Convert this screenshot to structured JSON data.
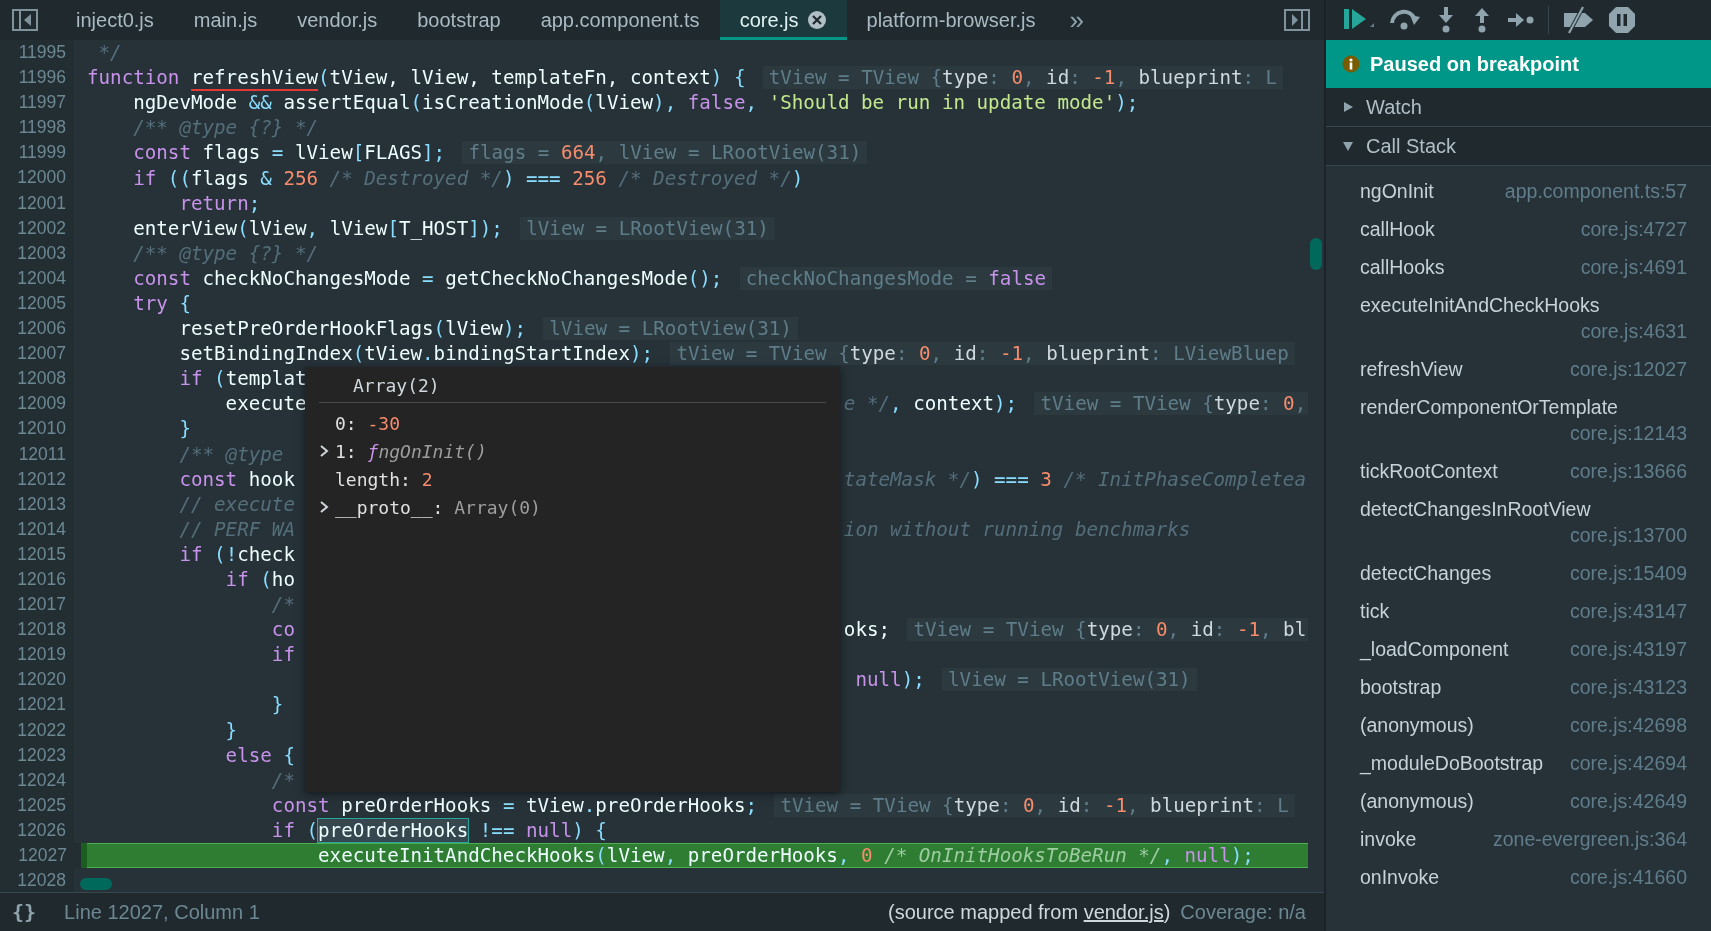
{
  "tabs": [
    {
      "label": "inject0.js",
      "selected": false
    },
    {
      "label": "main.js",
      "selected": false
    },
    {
      "label": "vendor.js",
      "selected": false
    },
    {
      "label": "bootstrap",
      "selected": false
    },
    {
      "label": "app.component.ts",
      "selected": false
    },
    {
      "label": "core.js",
      "selected": true
    },
    {
      "label": "platform-browser.js",
      "selected": false
    }
  ],
  "more_tabs": "»",
  "lines": [
    {
      "num": "11995",
      "paused": false,
      "code": [
        {
          "text": " */",
          "kind": "cm"
        }
      ]
    },
    {
      "num": "11996",
      "paused": false,
      "code": [
        {
          "text": "function ",
          "kind": "kw"
        },
        {
          "text": "refreshView",
          "kind": "hover"
        },
        {
          "text": "(",
          "kind": "pn"
        },
        {
          "text": "tView, lView, templateFn, context",
          "kind": "id"
        },
        {
          "text": ") {",
          "kind": "pn"
        }
      ],
      "hint": [
        {
          "text": "tView = TView {",
          "kind": "h"
        },
        {
          "text": "type",
          "kind": "key"
        },
        {
          "text": ": ",
          "kind": "h"
        },
        {
          "text": "0",
          "kind": "num"
        },
        {
          "text": ", ",
          "kind": "h"
        },
        {
          "text": "id",
          "kind": "key"
        },
        {
          "text": ": ",
          "kind": "h"
        },
        {
          "text": "-1",
          "kind": "num"
        },
        {
          "text": ", ",
          "kind": "h"
        },
        {
          "text": "blueprint",
          "kind": "key"
        },
        {
          "text": ": L",
          "kind": "h"
        }
      ]
    },
    {
      "num": "11997",
      "paused": false,
      "code": [
        {
          "text": "    ngDevMode ",
          "kind": "id"
        },
        {
          "text": "&&",
          "kind": "pn"
        },
        {
          "text": " assertEqual",
          "kind": "id"
        },
        {
          "text": "(",
          "kind": "pn"
        },
        {
          "text": "isCreationMode",
          "kind": "id"
        },
        {
          "text": "(",
          "kind": "pn"
        },
        {
          "text": "lView",
          "kind": "id"
        },
        {
          "text": "), ",
          "kind": "pn"
        },
        {
          "text": "false",
          "kind": "kw"
        },
        {
          "text": ", ",
          "kind": "pn"
        },
        {
          "text": "'Should be run in update mode'",
          "kind": "str"
        },
        {
          "text": ");",
          "kind": "pn"
        }
      ]
    },
    {
      "num": "11998",
      "paused": false,
      "code": [
        {
          "text": "    /** @type {?} */",
          "kind": "cm"
        }
      ]
    },
    {
      "num": "11999",
      "paused": false,
      "code": [
        {
          "text": "    const",
          "kind": "kw"
        },
        {
          "text": " flags ",
          "kind": "id"
        },
        {
          "text": "=",
          "kind": "pn"
        },
        {
          "text": " lView",
          "kind": "id"
        },
        {
          "text": "[",
          "kind": "pn"
        },
        {
          "text": "FLAGS",
          "kind": "id"
        },
        {
          "text": "];",
          "kind": "pn"
        }
      ],
      "hint": [
        {
          "text": "flags = ",
          "kind": "h"
        },
        {
          "text": "664",
          "kind": "num"
        },
        {
          "text": ", lView = LRootView(31)",
          "kind": "h"
        }
      ]
    },
    {
      "num": "12000",
      "paused": false,
      "code": [
        {
          "text": "    if",
          "kind": "kw"
        },
        {
          "text": " ((",
          "kind": "pn"
        },
        {
          "text": "flags ",
          "kind": "id"
        },
        {
          "text": "& ",
          "kind": "pn"
        },
        {
          "text": "256",
          "kind": "num"
        },
        {
          "text": " /* Destroyed */",
          "kind": "cm"
        },
        {
          "text": ")",
          "kind": "pn"
        },
        {
          "text": " === ",
          "kind": "pn"
        },
        {
          "text": "256",
          "kind": "num"
        },
        {
          "text": " /* Destroyed */",
          "kind": "cm"
        },
        {
          "text": ")",
          "kind": "pn"
        }
      ]
    },
    {
      "num": "12001",
      "paused": false,
      "code": [
        {
          "text": "        return",
          "kind": "kw"
        },
        {
          "text": ";",
          "kind": "pn"
        }
      ]
    },
    {
      "num": "12002",
      "paused": false,
      "code": [
        {
          "text": "    enterView",
          "kind": "id"
        },
        {
          "text": "(",
          "kind": "pn"
        },
        {
          "text": "lView",
          "kind": "id"
        },
        {
          "text": ", ",
          "kind": "pn"
        },
        {
          "text": "lView",
          "kind": "id"
        },
        {
          "text": "[",
          "kind": "pn"
        },
        {
          "text": "T_HOST",
          "kind": "id"
        },
        {
          "text": "]);",
          "kind": "pn"
        }
      ],
      "hint": [
        {
          "text": "lView = LRootView(31)",
          "kind": "h"
        }
      ]
    },
    {
      "num": "12003",
      "paused": false,
      "code": [
        {
          "text": "    /** @type {?} */",
          "kind": "cm"
        }
      ]
    },
    {
      "num": "12004",
      "paused": false,
      "code": [
        {
          "text": "    const",
          "kind": "kw"
        },
        {
          "text": " checkNoChangesMode ",
          "kind": "id"
        },
        {
          "text": "=",
          "kind": "pn"
        },
        {
          "text": " getCheckNoChangesMode",
          "kind": "id"
        },
        {
          "text": "();",
          "kind": "pn"
        }
      ],
      "hint": [
        {
          "text": "checkNoChangesMode = ",
          "kind": "h"
        },
        {
          "text": "false",
          "kind": "kw"
        }
      ]
    },
    {
      "num": "12005",
      "paused": false,
      "code": [
        {
          "text": "    try",
          "kind": "kw"
        },
        {
          "text": " {",
          "kind": "pn"
        }
      ]
    },
    {
      "num": "12006",
      "paused": false,
      "code": [
        {
          "text": "        resetPreOrderHookFlags",
          "kind": "id"
        },
        {
          "text": "(",
          "kind": "pn"
        },
        {
          "text": "lView",
          "kind": "id"
        },
        {
          "text": ");",
          "kind": "pn"
        }
      ],
      "hint": [
        {
          "text": "lView = LRootView(31)",
          "kind": "h"
        }
      ]
    },
    {
      "num": "12007",
      "paused": false,
      "code": [
        {
          "text": "        setBindingIndex",
          "kind": "id"
        },
        {
          "text": "(",
          "kind": "pn"
        },
        {
          "text": "tView",
          "kind": "id"
        },
        {
          "text": ".",
          "kind": "pn"
        },
        {
          "text": "bindingStartIndex",
          "kind": "id"
        },
        {
          "text": ");",
          "kind": "pn"
        }
      ],
      "hint": [
        {
          "text": "tView = TView {",
          "kind": "h"
        },
        {
          "text": "type",
          "kind": "key"
        },
        {
          "text": ": ",
          "kind": "h"
        },
        {
          "text": "0",
          "kind": "num"
        },
        {
          "text": ", ",
          "kind": "h"
        },
        {
          "text": "id",
          "kind": "key"
        },
        {
          "text": ": ",
          "kind": "h"
        },
        {
          "text": "-1",
          "kind": "num"
        },
        {
          "text": ", ",
          "kind": "h"
        },
        {
          "text": "blueprint",
          "kind": "key"
        },
        {
          "text": ": LViewBluep",
          "kind": "h"
        }
      ]
    },
    {
      "num": "12008",
      "paused": false,
      "code": [
        {
          "text": "        if",
          "kind": "kw"
        },
        {
          "text": " (",
          "kind": "pn"
        },
        {
          "text": "templat",
          "kind": "id"
        }
      ]
    },
    {
      "num": "12009",
      "paused": false,
      "code": [
        {
          "text": "            execute",
          "kind": "id"
        }
      ],
      "after": [
        {
          "text": "e */",
          "kind": "cm"
        },
        {
          "text": ", ",
          "kind": "pn"
        },
        {
          "text": "context",
          "kind": "id"
        },
        {
          "text": ");",
          "kind": "pn"
        }
      ],
      "after_hint": [
        {
          "text": "tView = TView {",
          "kind": "h"
        },
        {
          "text": "type",
          "kind": "key"
        },
        {
          "text": ": ",
          "kind": "h"
        },
        {
          "text": "0",
          "kind": "num"
        },
        {
          "text": ",",
          "kind": "h"
        }
      ]
    },
    {
      "num": "12010",
      "paused": false,
      "code": [
        {
          "text": "        }",
          "kind": "pn"
        }
      ]
    },
    {
      "num": "12011",
      "paused": false,
      "code": [
        {
          "text": "        /** @type",
          "kind": "cm"
        }
      ]
    },
    {
      "num": "12012",
      "paused": false,
      "code": [
        {
          "text": "        const",
          "kind": "kw"
        },
        {
          "text": " hook",
          "kind": "id"
        }
      ],
      "after": [
        {
          "text": "tateMask */",
          "kind": "cm"
        },
        {
          "text": ")",
          "kind": "pn"
        },
        {
          "text": " === ",
          "kind": "pn"
        },
        {
          "text": "3",
          "kind": "num"
        },
        {
          "text": " /* InitPhaseCompletea",
          "kind": "cm"
        }
      ]
    },
    {
      "num": "12013",
      "paused": false,
      "code": [
        {
          "text": "        // execute",
          "kind": "cm"
        }
      ]
    },
    {
      "num": "12014",
      "paused": false,
      "code": [
        {
          "text": "        // PERF WA",
          "kind": "cm"
        }
      ],
      "after": [
        {
          "text": "ion without running benchmarks",
          "kind": "cm"
        }
      ]
    },
    {
      "num": "12015",
      "paused": false,
      "code": [
        {
          "text": "        if",
          "kind": "kw"
        },
        {
          "text": " (!",
          "kind": "pn"
        },
        {
          "text": "check",
          "kind": "id"
        }
      ]
    },
    {
      "num": "12016",
      "paused": false,
      "code": [
        {
          "text": "            if",
          "kind": "kw"
        },
        {
          "text": " (",
          "kind": "pn"
        },
        {
          "text": "ho",
          "kind": "id"
        }
      ]
    },
    {
      "num": "12017",
      "paused": false,
      "code": [
        {
          "text": "                /*",
          "kind": "cm"
        }
      ]
    },
    {
      "num": "12018",
      "paused": false,
      "code": [
        {
          "text": "                co",
          "kind": "kw"
        }
      ],
      "after": [
        {
          "text": "oks;",
          "kind": "id"
        }
      ],
      "after_hint": [
        {
          "text": "tView = TView {",
          "kind": "h"
        },
        {
          "text": "type",
          "kind": "key"
        },
        {
          "text": ": ",
          "kind": "h"
        },
        {
          "text": "0",
          "kind": "num"
        },
        {
          "text": ", ",
          "kind": "h"
        },
        {
          "text": "id",
          "kind": "key"
        },
        {
          "text": ": ",
          "kind": "h"
        },
        {
          "text": "-1",
          "kind": "num"
        },
        {
          "text": ", ",
          "kind": "h"
        },
        {
          "text": "bl",
          "kind": "key"
        }
      ]
    },
    {
      "num": "12019",
      "paused": false,
      "code": [
        {
          "text": "                if",
          "kind": "kw"
        }
      ]
    },
    {
      "num": "12020",
      "paused": false,
      "after": [
        {
          "text": " null",
          "kind": "kw"
        },
        {
          "text": ");",
          "kind": "pn"
        }
      ],
      "after_hint": [
        {
          "text": "lView = LRootView(31)",
          "kind": "h"
        }
      ]
    },
    {
      "num": "12021",
      "paused": false,
      "code": [
        {
          "text": "                }",
          "kind": "pn"
        }
      ]
    },
    {
      "num": "12022",
      "paused": false,
      "code": [
        {
          "text": "            }",
          "kind": "pn"
        }
      ]
    },
    {
      "num": "12023",
      "paused": false,
      "code": [
        {
          "text": "            else",
          "kind": "kw"
        },
        {
          "text": " {",
          "kind": "pn"
        }
      ]
    },
    {
      "num": "12024",
      "paused": false,
      "code": [
        {
          "text": "                /*",
          "kind": "cm"
        }
      ]
    },
    {
      "num": "12025",
      "paused": false,
      "code": [
        {
          "text": "                const",
          "kind": "kw"
        },
        {
          "text": " preOrderHooks ",
          "kind": "id"
        },
        {
          "text": "=",
          "kind": "pn"
        },
        {
          "text": " tView",
          "kind": "id"
        },
        {
          "text": ".",
          "kind": "pn"
        },
        {
          "text": "preOrderHooks",
          "kind": "id"
        },
        {
          "text": ";",
          "kind": "pn"
        }
      ],
      "hint": [
        {
          "text": "tView = TView {",
          "kind": "h"
        },
        {
          "text": "type",
          "kind": "key"
        },
        {
          "text": ": ",
          "kind": "h"
        },
        {
          "text": "0",
          "kind": "num"
        },
        {
          "text": ", ",
          "kind": "h"
        },
        {
          "text": "id",
          "kind": "key"
        },
        {
          "text": ": ",
          "kind": "h"
        },
        {
          "text": "-1",
          "kind": "num"
        },
        {
          "text": ", ",
          "kind": "h"
        },
        {
          "text": "blueprint",
          "kind": "key"
        },
        {
          "text": ": L",
          "kind": "h"
        }
      ]
    },
    {
      "num": "12026",
      "paused": false,
      "code": [
        {
          "text": "                if",
          "kind": "kw"
        },
        {
          "text": " (",
          "kind": "pn"
        },
        {
          "text": "preOrderHooks",
          "kind": "hl"
        },
        {
          "text": " !==",
          "kind": "pn"
        },
        {
          "text": " null",
          "kind": "kw"
        },
        {
          "text": ") {",
          "kind": "pn"
        }
      ]
    },
    {
      "num": "12027",
      "paused": true,
      "code": [
        {
          "text": "                    executeInitAndCheckHooks",
          "kind": "id"
        },
        {
          "text": "(",
          "kind": "pn"
        },
        {
          "text": "lView",
          "kind": "id"
        },
        {
          "text": ", ",
          "kind": "pn"
        },
        {
          "text": "preOrderHooks",
          "kind": "id"
        },
        {
          "text": ", ",
          "kind": "pn"
        },
        {
          "text": "0",
          "kind": "num"
        },
        {
          "text": " /* OnInitHooksToBeRun */",
          "kind": "cm"
        },
        {
          "text": ", ",
          "kind": "pn"
        },
        {
          "text": "null",
          "kind": "kw"
        },
        {
          "text": ");",
          "kind": "pn"
        }
      ]
    },
    {
      "num": "12028",
      "paused": false
    }
  ],
  "popover": {
    "title": "Array(2)",
    "rows": [
      {
        "expandable": false,
        "key": "0:",
        "value": "-30",
        "kind": "number"
      },
      {
        "expandable": true,
        "key": "1:",
        "prefix": "ƒ",
        "value": "ngOnInit()",
        "kind": "function"
      },
      {
        "expandable": false,
        "key": "length:",
        "value": "2",
        "kind": "number"
      },
      {
        "expandable": true,
        "key": "__proto__:",
        "value": "Array(0)",
        "kind": "object"
      }
    ]
  },
  "status_bar": {
    "format": "{}",
    "position": "Line 12027, Column 1",
    "source_note": {
      "before": "(source mapped from ",
      "link": "vendor.js",
      "after": ")"
    },
    "coverage": "Coverage: n/a"
  },
  "debugger": {
    "banner": "Paused on breakpoint",
    "sections": [
      {
        "label": "Watch",
        "expanded": false
      },
      {
        "label": "Call Stack",
        "expanded": true
      }
    ],
    "call_stack": [
      {
        "name": "ngOnInit",
        "location": "app.component.ts:57"
      },
      {
        "name": "callHook",
        "location": "core.js:4727"
      },
      {
        "name": "callHooks",
        "location": "core.js:4691"
      },
      {
        "name": "executeInitAndCheckHooks",
        "location": "core.js:4631"
      },
      {
        "name": "refreshView",
        "location": "core.js:12027"
      },
      {
        "name": "renderComponentOrTemplate",
        "location": "core.js:12143"
      },
      {
        "name": "tickRootContext",
        "location": "core.js:13666"
      },
      {
        "name": "detectChangesInRootView",
        "location": "core.js:13700"
      },
      {
        "name": "detectChanges",
        "location": "core.js:15409"
      },
      {
        "name": "tick",
        "location": "core.js:43147"
      },
      {
        "name": "_loadComponent",
        "location": "core.js:43197"
      },
      {
        "name": "bootstrap",
        "location": "core.js:43123"
      },
      {
        "name": "(anonymous)",
        "location": "core.js:42698"
      },
      {
        "name": "_moduleDoBootstrap",
        "location": "core.js:42694"
      },
      {
        "name": "(anonymous)",
        "location": "core.js:42649"
      },
      {
        "name": "invoke",
        "location": "zone-evergreen.js:364"
      },
      {
        "name": "onInvoke",
        "location": "core.js:41660"
      }
    ]
  }
}
